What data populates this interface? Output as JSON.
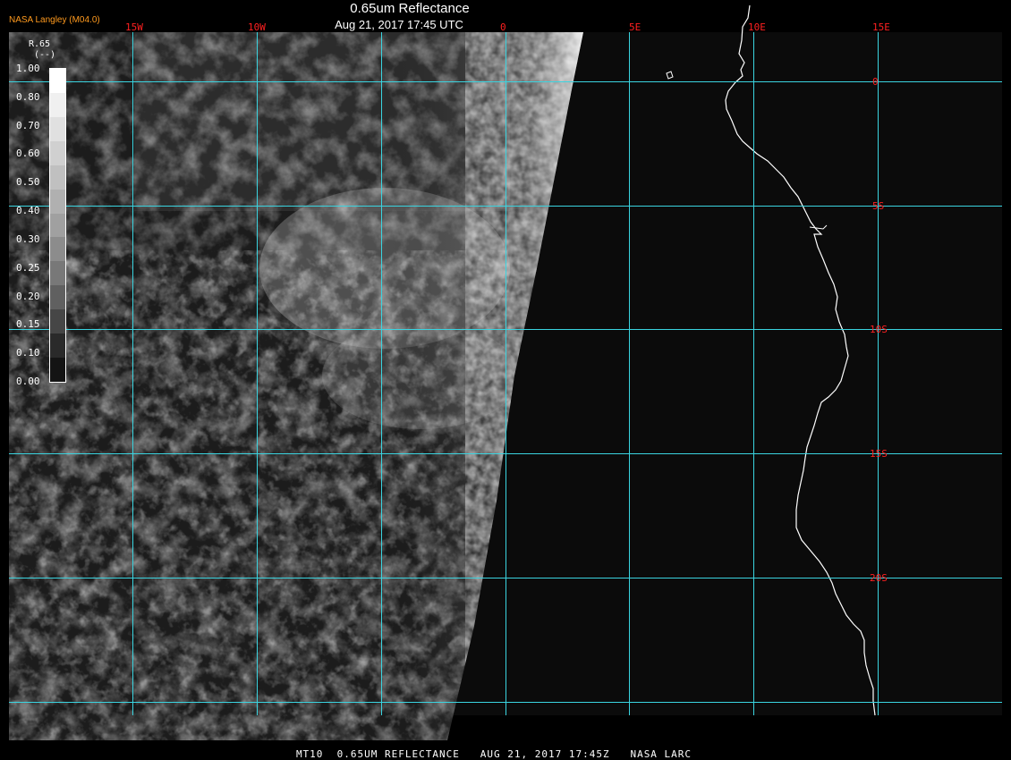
{
  "header": {
    "title": "0.65um Reflectance",
    "subtitle": "Aug 21, 2017 17:45 UTC",
    "credit": "NASA Langley (M04.0)"
  },
  "footer": {
    "text": "MT10  0.65UM REFLECTANCE   AUG 21, 2017 17:45Z   NASA LARC"
  },
  "legend": {
    "title": "R.65",
    "unit": "(--)",
    "ticks": [
      "1.00",
      "0.80",
      "0.70",
      "0.60",
      "0.50",
      "0.40",
      "0.30",
      "0.25",
      "0.20",
      "0.15",
      "0.10",
      "0.00"
    ],
    "grays": [
      "#ffffff",
      "#f0f0f0",
      "#e0e0e0",
      "#d0d0d0",
      "#c0c0c0",
      "#b0b0b0",
      "#a0a0a0",
      "#8c8c8c",
      "#787878",
      "#606060",
      "#464646",
      "#2a2a2a",
      "#141414"
    ]
  },
  "map": {
    "longitude_labels": [
      "15W",
      "10W",
      "0",
      "5E",
      "10E",
      "15E"
    ],
    "latitude_labels": [
      "0",
      "5S",
      "10S",
      "15S",
      "20S"
    ],
    "gridline_color": "#3ad4e0",
    "label_color": "#ff2020",
    "coastline_color": "#ffffff",
    "ocean_color": "#0b0b0b"
  }
}
